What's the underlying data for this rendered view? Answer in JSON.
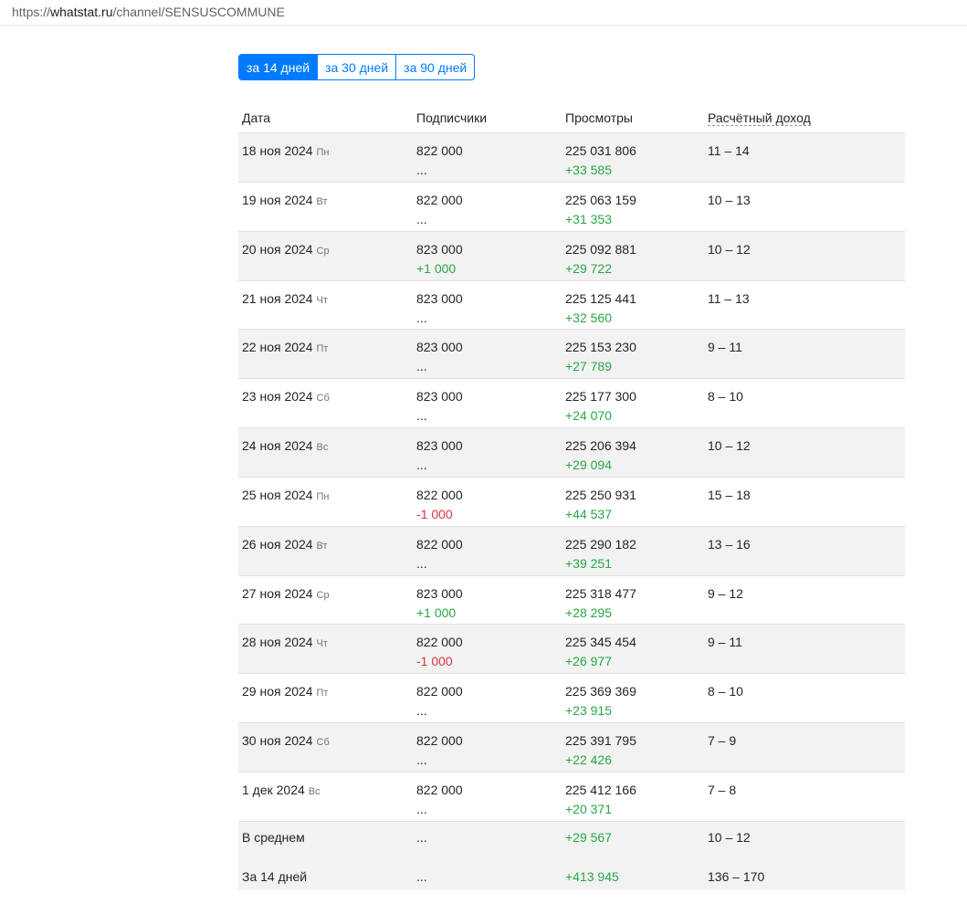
{
  "url": {
    "prefix": "https://",
    "host": "whatstat.ru",
    "path": "/channel/SENSUSCOMMUNE"
  },
  "periods": [
    "за 14 дней",
    "за 30 дней",
    "за 90 дней"
  ],
  "headers": {
    "date": "Дата",
    "subs": "Подписчики",
    "views": "Просмотры",
    "income": "Расчётный доход"
  },
  "rows": [
    {
      "date": "18 ноя 2024",
      "dow": "Пн",
      "subs": "822 000",
      "subs_delta": "...",
      "views": "225 031 806",
      "views_delta": "+33 585",
      "income": "11 – 14"
    },
    {
      "date": "19 ноя 2024",
      "dow": "Вт",
      "subs": "822 000",
      "subs_delta": "...",
      "views": "225 063 159",
      "views_delta": "+31 353",
      "income": "10 – 13"
    },
    {
      "date": "20 ноя 2024",
      "dow": "Ср",
      "subs": "823 000",
      "subs_delta": "+1 000",
      "views": "225 092 881",
      "views_delta": "+29 722",
      "income": "10 – 12"
    },
    {
      "date": "21 ноя 2024",
      "dow": "Чт",
      "subs": "823 000",
      "subs_delta": "...",
      "views": "225 125 441",
      "views_delta": "+32 560",
      "income": "11 – 13"
    },
    {
      "date": "22 ноя 2024",
      "dow": "Пт",
      "subs": "823 000",
      "subs_delta": "...",
      "views": "225 153 230",
      "views_delta": "+27 789",
      "income": "9 – 11"
    },
    {
      "date": "23 ноя 2024",
      "dow": "Сб",
      "subs": "823 000",
      "subs_delta": "...",
      "views": "225 177 300",
      "views_delta": "+24 070",
      "income": "8 – 10"
    },
    {
      "date": "24 ноя 2024",
      "dow": "Вс",
      "subs": "823 000",
      "subs_delta": "...",
      "views": "225 206 394",
      "views_delta": "+29 094",
      "income": "10 – 12"
    },
    {
      "date": "25 ноя 2024",
      "dow": "Пн",
      "subs": "822 000",
      "subs_delta": "-1 000",
      "views": "225 250 931",
      "views_delta": "+44 537",
      "income": "15 – 18"
    },
    {
      "date": "26 ноя 2024",
      "dow": "Вт",
      "subs": "822 000",
      "subs_delta": "...",
      "views": "225 290 182",
      "views_delta": "+39 251",
      "income": "13 – 16"
    },
    {
      "date": "27 ноя 2024",
      "dow": "Ср",
      "subs": "823 000",
      "subs_delta": "+1 000",
      "views": "225 318 477",
      "views_delta": "+28 295",
      "income": "9 – 12"
    },
    {
      "date": "28 ноя 2024",
      "dow": "Чт",
      "subs": "822 000",
      "subs_delta": "-1 000",
      "views": "225 345 454",
      "views_delta": "+26 977",
      "income": "9 – 11"
    },
    {
      "date": "29 ноя 2024",
      "dow": "Пт",
      "subs": "822 000",
      "subs_delta": "...",
      "views": "225 369 369",
      "views_delta": "+23 915",
      "income": "8 – 10"
    },
    {
      "date": "30 ноя 2024",
      "dow": "Сб",
      "subs": "822 000",
      "subs_delta": "...",
      "views": "225 391 795",
      "views_delta": "+22 426",
      "income": "7 – 9"
    },
    {
      "date": "1 дек 2024",
      "dow": "Вс",
      "subs": "822 000",
      "subs_delta": "...",
      "views": "225 412 166",
      "views_delta": "+20 371",
      "income": "7 – 8"
    }
  ],
  "average": {
    "label": "В среднем",
    "subs": "...",
    "views": "+29 567",
    "income": "10 – 12"
  },
  "total": {
    "label": "За 14 дней",
    "subs": "...",
    "views": "+413 945",
    "income": "136 – 170"
  }
}
